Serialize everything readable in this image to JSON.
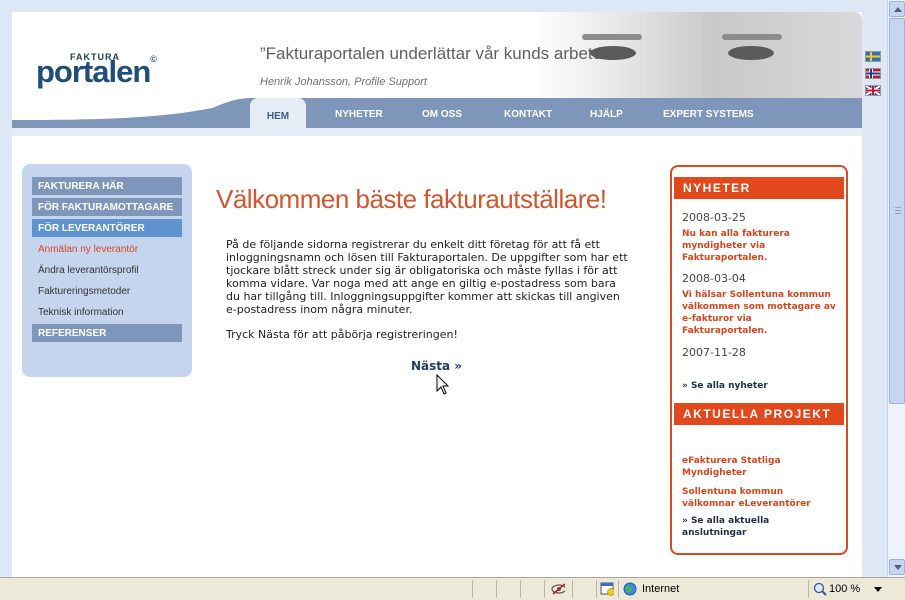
{
  "header": {
    "logo_small": "FAKTURA",
    "logo_main": "portalen",
    "logo_reg": "©",
    "quote": "”Fakturaportalen underlättar vår kunds arbete.”",
    "quote_author": "Henrik Johansson, Profile Support"
  },
  "nav": {
    "items": [
      "HEM",
      "NYHETER",
      "OM OSS",
      "KONTAKT",
      "HJÄLP",
      "EXPERT SYSTEMS"
    ],
    "active": "HEM"
  },
  "sidebar": {
    "sections": [
      {
        "label": "FAKTURERA HÄR"
      },
      {
        "label": "FÖR FAKTURAMOTTAGARE"
      },
      {
        "label": "FÖR LEVERANTÖRER"
      }
    ],
    "links": [
      {
        "label": "Anmälan ny leverantör"
      },
      {
        "label": "Ändra leverantörsprofil"
      },
      {
        "label": "Faktureringsmetoder"
      },
      {
        "label": "Teknisk information"
      }
    ],
    "references": "REFERENSER"
  },
  "main": {
    "title": "Välkommen bäste fakturautställare!",
    "intro_lines": [
      "På de följande sidorna registrerar du enkelt ditt företag för att få ett",
      "inloggningsnamn och lösen till Fakturaportalen. De uppgifter som har ett",
      "tjockare blått streck under sig är obligatoriska och måste fyllas i för att",
      "komma vidare. Var noga med att ange en giltig e-postadress som bara",
      "du har tillgång till. Inloggningsuppgifter kommer att skickas till angiven",
      "e-postadress inom några minuter."
    ],
    "instruction": "Tryck Nästa för att påbörja registreringen!",
    "next": "Nästa »"
  },
  "news": {
    "heading": "NYHETER",
    "items": [
      {
        "date": "2008-03-25",
        "lines": [
          "Nu kan alla fakturera",
          "myndigheter via",
          "Fakturaportalen."
        ]
      },
      {
        "date": "2008-03-04",
        "lines": [
          "Vi hälsar Sollentuna kommun",
          "välkommen som mottagare av",
          "e-fakturor via",
          "Fakturaportalen."
        ]
      },
      {
        "date": "2007-11-28",
        "lines": []
      }
    ],
    "see_all": "» Se alla nyheter"
  },
  "projects": {
    "heading": "AKTUELLA PROJEKT",
    "items": [
      {
        "lines": [
          "eFakturera Statliga",
          "Myndigheter"
        ]
      },
      {
        "lines": [
          "Sollentuna kommun",
          "välkomnar eLeverantörer"
        ]
      }
    ],
    "see_all_lines": [
      "» Se alla aktuella",
      "anslutningar"
    ]
  },
  "statusbar": {
    "zone": "Internet",
    "zoom": "100 %"
  },
  "colors": {
    "brand_blue": "#1f4f78",
    "accent_orange": "#e1481b",
    "nav_blue": "#7e96b9"
  }
}
